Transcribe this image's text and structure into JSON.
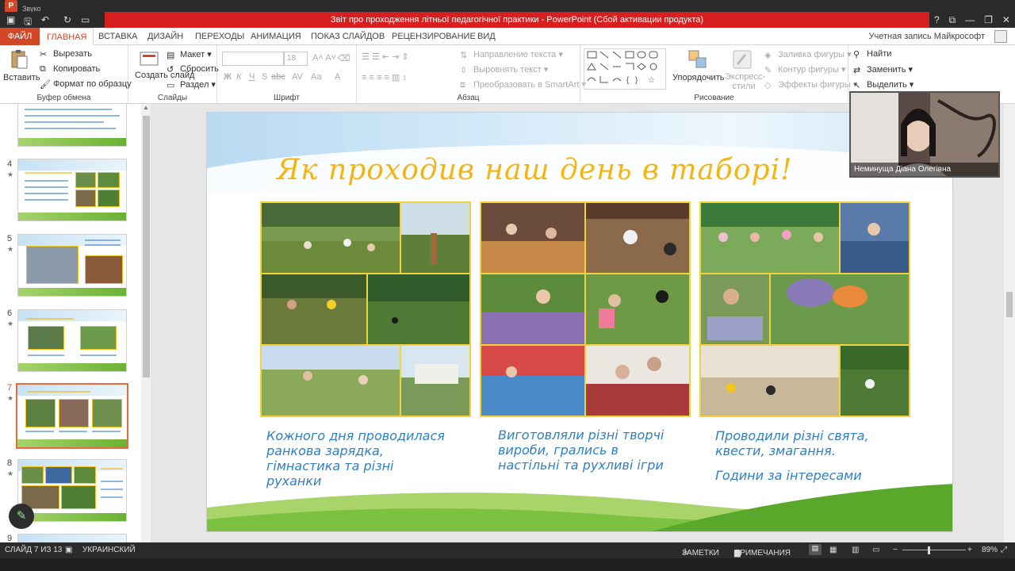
{
  "window": {
    "zoom_hint": "Звуко",
    "title": "Звіт про проходження літньої педагогічної практики - PowerPoint (Сбой активации продукта)"
  },
  "ribbon_tabs": [
    "ФАЙЛ",
    "ГЛАВНАЯ",
    "ВСТАВКА",
    "ДИЗАЙН",
    "ПЕРЕХОДЫ",
    "АНИМАЦИЯ",
    "ПОКАЗ СЛАЙДОВ",
    "РЕЦЕНЗИРОВАНИЕ",
    "ВИД"
  ],
  "account": "Учетная запись Майкрософт",
  "clipboard": {
    "paste": "Вставить",
    "cut": "Вырезать",
    "copy": "Копировать",
    "format_painter": "Формат по образцу",
    "label": "Буфер обмена"
  },
  "slides_group": {
    "new_slide": "Создать слайд",
    "layout": "Макет",
    "reset": "Сбросить",
    "section": "Раздел",
    "label": "Слайды"
  },
  "font_group": {
    "size": "18",
    "label": "Шрифт",
    "bold": "Ж",
    "italic": "К",
    "underline": "Ч",
    "strike": "S",
    "spacing": "abc",
    "case": "Аа"
  },
  "paragraph_group": {
    "text_dir": "Направление текста",
    "align_text": "Выровнять текст",
    "smartart": "Преобразовать в SmartArt",
    "label": "Абзац"
  },
  "drawing_group": {
    "arrange": "Упорядочить",
    "quick_styles": "Экспресс-стили",
    "fill": "Заливка фигуры",
    "outline": "Контур фигуры",
    "effects": "Эффекты фигуры",
    "label": "Рисование"
  },
  "editing_group": {
    "find": "Найти",
    "replace": "Заменить",
    "select": "Выделить"
  },
  "thumbnails": [
    {
      "num": "4",
      "star": "★"
    },
    {
      "num": "5",
      "star": "★"
    },
    {
      "num": "6",
      "star": "★"
    },
    {
      "num": "7",
      "star": "★"
    },
    {
      "num": "8",
      "star": "★"
    },
    {
      "num": "9",
      "star": ""
    }
  ],
  "slide": {
    "title": "Як проходив наш день в таборі!",
    "captions": [
      "Кожного дня проводилася ранкова зарядка, гімнастика та різні руханки",
      "Виготовляли різні творчі вироби, грались в настільні та рухливі ігри",
      "Проводили різні свята, квести, змагання."
    ],
    "caption_extra": "Години за інтересами"
  },
  "webcam": {
    "name": "Неминуща Діана Олегівна"
  },
  "status": {
    "slide_info": "СЛАЙД 7 ИЗ 13",
    "language": "УКРАИНСКИЙ",
    "notes": "ЗАМЕТКИ",
    "comments": "ПРИМЕЧАНИЯ",
    "zoom": "89%"
  },
  "colors": {
    "accent": "#d24726",
    "title_bar": "#d71f1f",
    "slide_title": "#f2b514",
    "caption": "#2f7fc4"
  }
}
